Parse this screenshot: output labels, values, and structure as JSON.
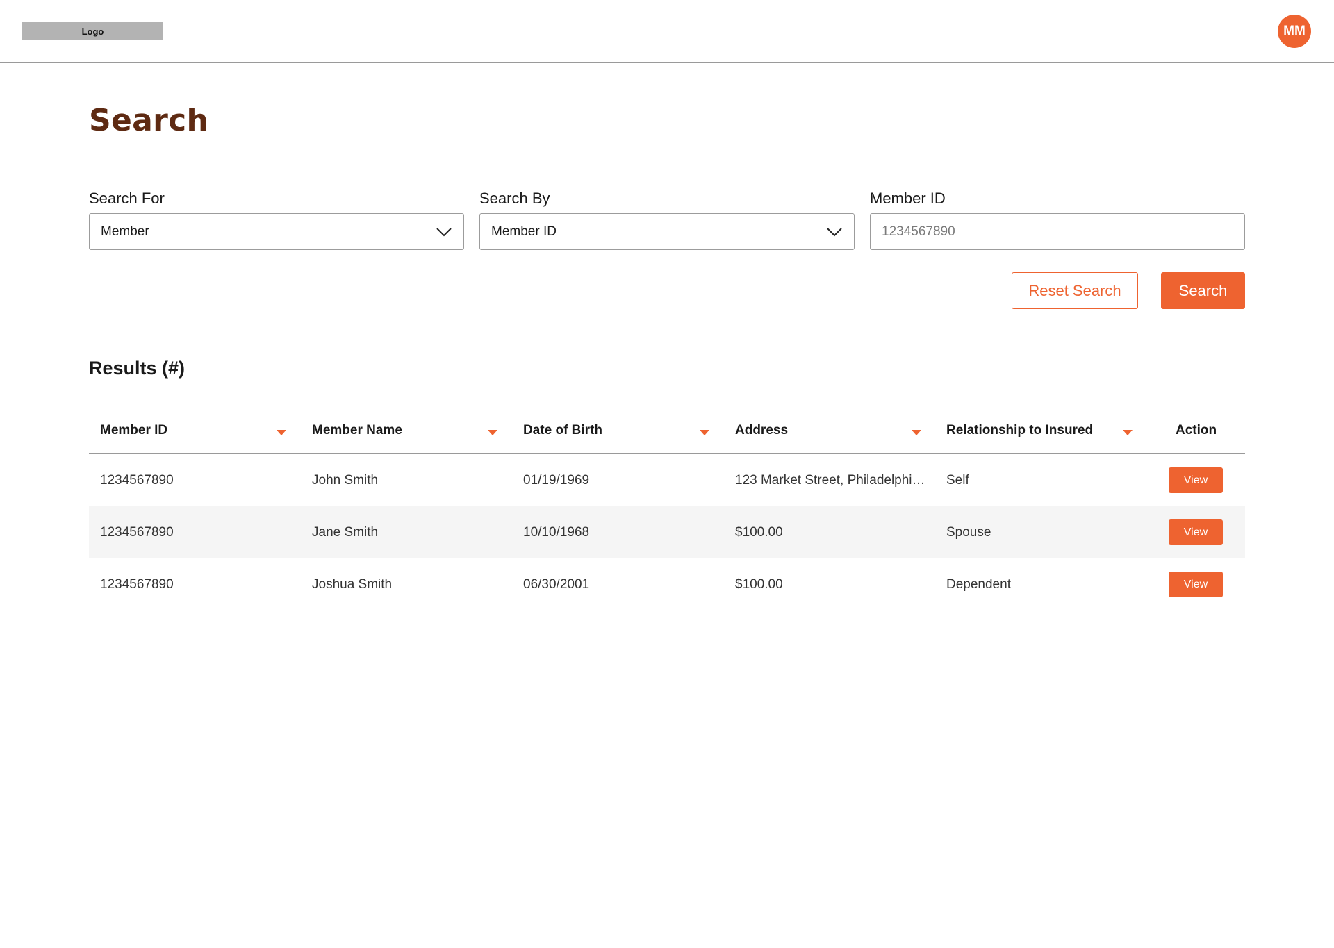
{
  "header": {
    "logo_text": "Logo",
    "avatar_initials": "MM"
  },
  "page": {
    "title": "Search"
  },
  "form": {
    "search_for": {
      "label": "Search For",
      "value": "Member"
    },
    "search_by": {
      "label": "Search By",
      "value": "Member ID"
    },
    "member_id": {
      "label": "Member ID",
      "placeholder": "1234567890"
    },
    "reset_label": "Reset Search",
    "search_label": "Search"
  },
  "results": {
    "title": "Results (#)",
    "columns": [
      "Member ID",
      "Member Name",
      "Date of Birth",
      "Address",
      "Relationship to Insured",
      "Action"
    ],
    "rows": [
      {
        "member_id": "1234567890",
        "name": "John Smith",
        "dob": "01/19/1969",
        "address": "123 Market Street, Philadelphi…",
        "relationship": "Self",
        "action": "View"
      },
      {
        "member_id": "1234567890",
        "name": "Jane Smith",
        "dob": "10/10/1968",
        "address": "$100.00",
        "relationship": "Spouse",
        "action": "View"
      },
      {
        "member_id": "1234567890",
        "name": "Joshua Smith",
        "dob": "06/30/2001",
        "address": "$100.00",
        "relationship": "Dependent",
        "action": "View"
      }
    ]
  },
  "colors": {
    "accent": "#ee6330",
    "title": "#5e2a12"
  },
  "icons": {
    "dropdown": "chevron-down-icon",
    "sort": "sort-down-icon"
  }
}
